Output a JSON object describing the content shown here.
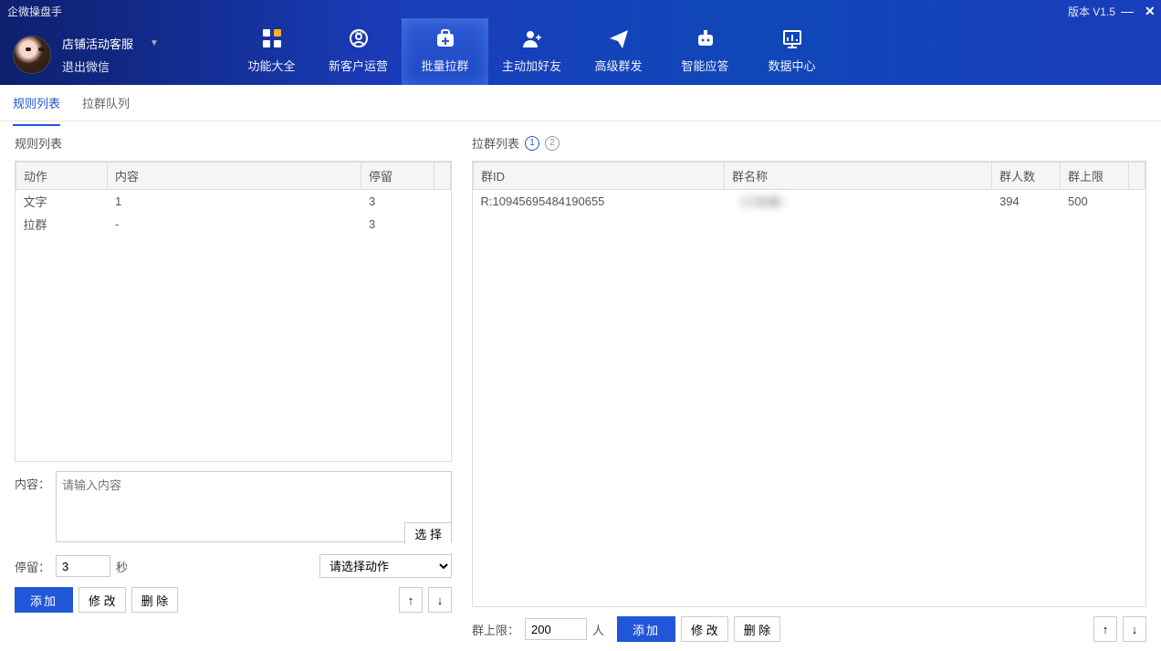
{
  "app": {
    "title": "企微操盘手",
    "version": "版本 V1.5"
  },
  "user": {
    "name": "店铺活动客服",
    "logout": "退出微信"
  },
  "nav": [
    {
      "id": "features",
      "label": "功能大全"
    },
    {
      "id": "newcust",
      "label": "新客户运营"
    },
    {
      "id": "pull",
      "label": "批量拉群"
    },
    {
      "id": "addfriend",
      "label": "主动加好友"
    },
    {
      "id": "broadcast",
      "label": "高级群发"
    },
    {
      "id": "autoreply",
      "label": "智能应答"
    },
    {
      "id": "data",
      "label": "数据中心"
    }
  ],
  "tabs": {
    "rules": "规则列表",
    "queue": "拉群队列"
  },
  "left": {
    "title": "规则列表",
    "headers": {
      "action": "动作",
      "content": "内容",
      "stay": "停留"
    },
    "rows": [
      {
        "action": "文字",
        "content": "1",
        "stay": "3"
      },
      {
        "action": "拉群",
        "content": "-",
        "stay": "3"
      }
    ],
    "content_label": "内容：",
    "content_placeholder": "请输入内容",
    "select_btn": "选 择",
    "stay_label": "停留：",
    "stay_value": "3",
    "stay_unit": "秒",
    "action_select_placeholder": "请选择动作",
    "add": "添加",
    "edit": "修 改",
    "delete": "删 除",
    "up": "↑",
    "down": "↓"
  },
  "right": {
    "title": "拉群列表",
    "headers": {
      "id": "群ID",
      "name": "群名称",
      "count": "群人数",
      "limit": "群上限"
    },
    "rows": [
      {
        "id": "R:10945695484190655",
        "name": "（已隐藏）",
        "count": "394",
        "limit": "500"
      }
    ],
    "limit_label": "群上限：",
    "limit_value": "200",
    "limit_unit": "人",
    "add": "添加",
    "edit": "修 改",
    "delete": "删 除",
    "up": "↑",
    "down": "↓"
  }
}
